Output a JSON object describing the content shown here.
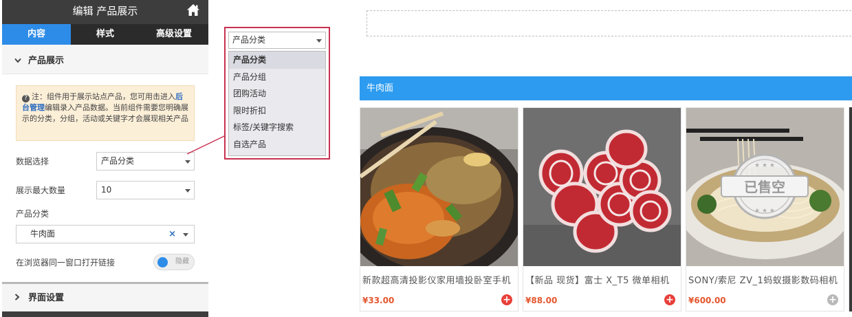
{
  "panel": {
    "title": "编辑 产品展示",
    "tabs": [
      {
        "label": "内容",
        "active": true
      },
      {
        "label": "样式",
        "active": false
      },
      {
        "label": "高级设置",
        "active": false
      }
    ],
    "section_product": {
      "title": "产品展示",
      "notice_prefix": "注：组件用于展示站点产品，您可用击进入",
      "notice_link": "后台管理",
      "notice_suffix": "编辑录入产品数据。当前组件需要您明确展示的分类，分组，活动或关键字才会展现相关产品",
      "data_select_label": "数据选择",
      "data_select_value": "产品分类",
      "max_count_label": "展示最大数量",
      "max_count_value": "10",
      "category_label": "产品分类",
      "category_value": "牛肉面",
      "category_clear": "×",
      "same_window_label": "在浏览器同一窗口打开链接",
      "same_window_toggle_label": "隐藏"
    },
    "section_ui": {
      "title": "界面设置"
    }
  },
  "dropdown": {
    "selected": "产品分类",
    "options": [
      "产品分类",
      "产品分组",
      "团购活动",
      "限时折扣",
      "标签/关键字搜索",
      "自选产品"
    ]
  },
  "preview": {
    "category_bar": "牛肉面",
    "products": [
      {
        "title": "新款超高清投影仪家用墙投卧室手机",
        "price": "¥33.00",
        "add_enabled": true
      },
      {
        "title": "【新品 现货】富士 X_T5 微单相机",
        "price": "¥88.00",
        "add_enabled": true
      },
      {
        "title": "SONY/索尼 ZV_1蚂蚁摄影数码相机",
        "price": "¥600.00",
        "add_enabled": false,
        "stamp": "已售空"
      }
    ]
  },
  "colors": {
    "accent_blue": "#2d8ce8",
    "bar_blue": "#2d9cf0",
    "highlight_red": "#c8304f",
    "price_orange": "#e4572e",
    "add_red": "#e8403a"
  }
}
